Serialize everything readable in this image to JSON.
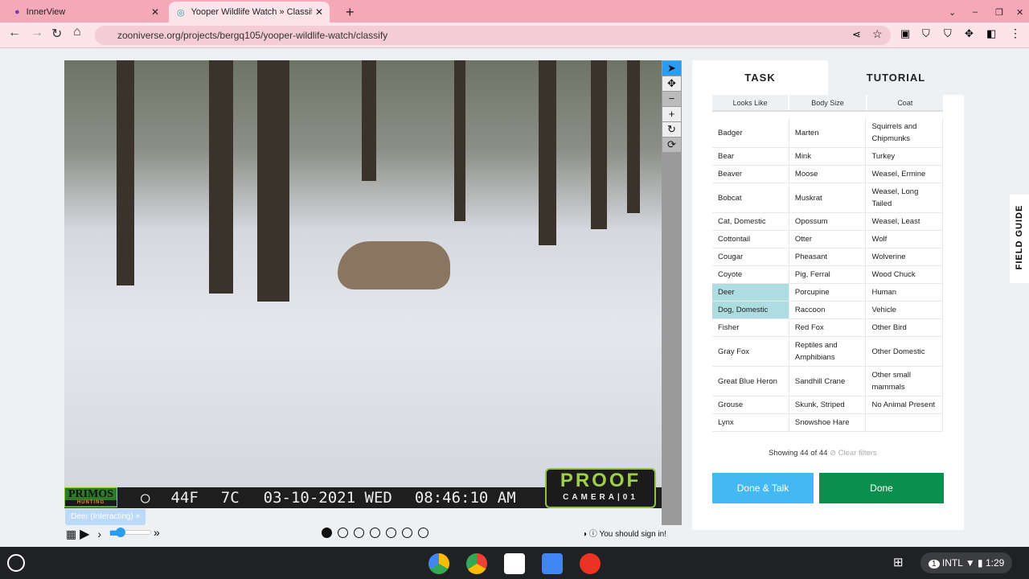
{
  "browser": {
    "tabs": [
      {
        "title": "InnerView"
      },
      {
        "title": "Yooper Wildlife Watch » Classify"
      }
    ],
    "url": "zooniverse.org/projects/bergq105/yooper-wildlife-watch/classify"
  },
  "camera": {
    "brand": "PRIMOS",
    "brand_sub": "HUNTING",
    "temp_f": "44F",
    "temp_c": "7C",
    "date": "03-10-2021 WED",
    "time": "08:46:10 AM",
    "logo": "PROOF",
    "logo_sub": "CAMERA|01"
  },
  "subject_tag": {
    "label": "Deer (Interacting)",
    "close": "×"
  },
  "frames": {
    "count": 7,
    "current": 1
  },
  "sign_in": "You should sign in!",
  "panel": {
    "tabs": [
      "TASK",
      "TUTORIAL"
    ],
    "filters": [
      "Looks Like",
      "Body Size",
      "Coat"
    ],
    "rows": [
      [
        "Badger",
        "Marten",
        "Squirrels and Chipmunks"
      ],
      [
        "Bear",
        "Mink",
        "Turkey"
      ],
      [
        "Beaver",
        "Moose",
        "Weasel, Ermine"
      ],
      [
        "Bobcat",
        "Muskrat",
        "Weasel, Long Tailed"
      ],
      [
        "Cat, Domestic",
        "Opossum",
        "Weasel, Least"
      ],
      [
        "Cottontail",
        "Otter",
        "Wolf"
      ],
      [
        "Cougar",
        "Pheasant",
        "Wolverine"
      ],
      [
        "Coyote",
        "Pig, Ferral",
        "Wood Chuck"
      ],
      [
        "Deer",
        "Porcupine",
        "Human"
      ],
      [
        "Dog, Domestic",
        "Raccoon",
        "Vehicle"
      ],
      [
        "Fisher",
        "Red Fox",
        "Other Bird"
      ],
      [
        "Gray Fox",
        "Reptiles and Amphibians",
        "Other Domestic"
      ],
      [
        "Great Blue Heron",
        "Sandhill Crane",
        "Other small mammals"
      ],
      [
        "Grouse",
        "Skunk, Striped",
        "No Animal Present"
      ],
      [
        "Lynx",
        "Snowshoe Hare",
        ""
      ]
    ],
    "selected": [
      "Deer",
      "Dog, Domestic"
    ],
    "showing": "Showing 44 of 44",
    "clear": "Clear filters",
    "done_talk": "Done & Talk",
    "done": "Done"
  },
  "field_guide": "FIELD GUIDE",
  "tray": {
    "locale": "INTL",
    "time": "1:29",
    "notifications": "1"
  }
}
